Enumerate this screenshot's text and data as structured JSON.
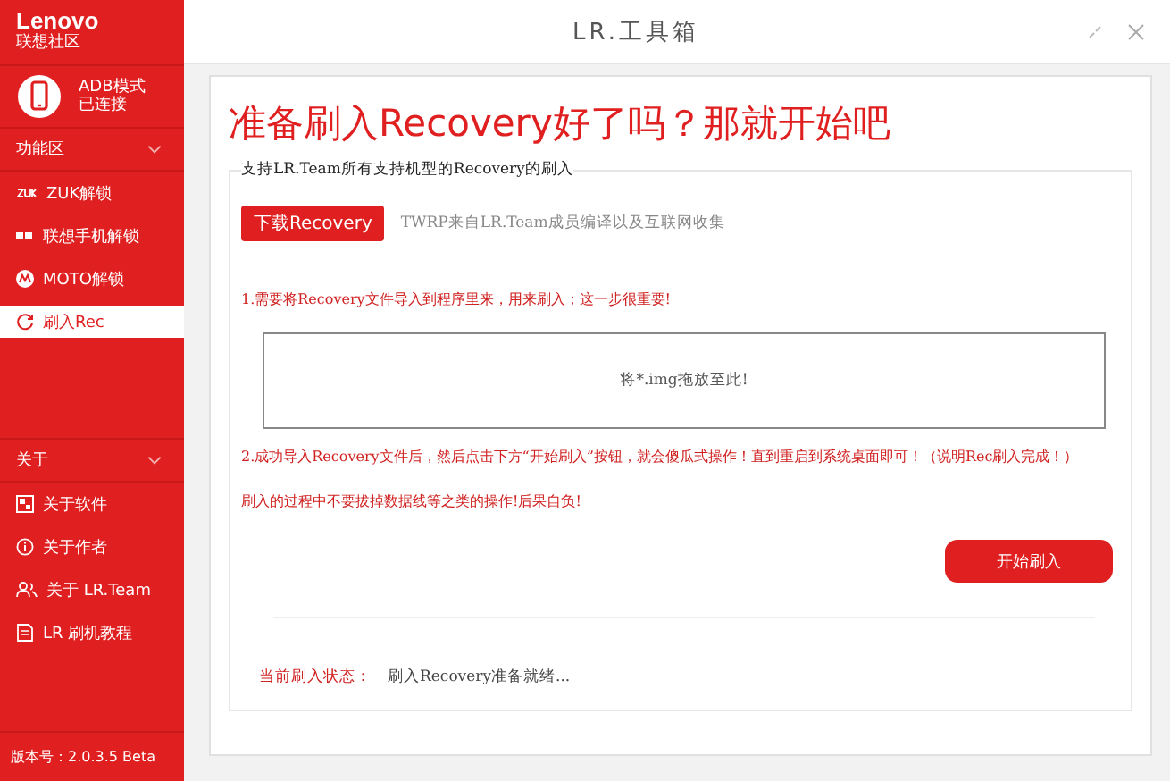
{
  "brand": {
    "name": "Lenovo",
    "subtitle": "联想社区"
  },
  "device": {
    "status_line1": "ADB模式",
    "status_line2": "已连接"
  },
  "sections": [
    {
      "title": "功能区",
      "expanded": true,
      "items": [
        {
          "label": "ZUK解锁",
          "kind": "zuk",
          "selected": false
        },
        {
          "label": "联想手机解锁",
          "kind": "grid",
          "selected": false
        },
        {
          "label": "MOTO解锁",
          "kind": "moto",
          "selected": false
        },
        {
          "label": "刷入Rec",
          "kind": "refresh",
          "selected": true
        }
      ]
    },
    {
      "title": "关于",
      "expanded": true,
      "items": [
        {
          "label": "关于软件",
          "kind": "app",
          "selected": false
        },
        {
          "label": "关于作者",
          "kind": "info",
          "selected": false
        },
        {
          "label": "关于 LR.Team",
          "kind": "people",
          "selected": false
        },
        {
          "label": "LR 刷机教程",
          "kind": "doc",
          "selected": false
        }
      ]
    }
  ],
  "version": "版本号：2.0.3.5 Beta",
  "window": {
    "title": "LR.工具箱"
  },
  "headline": "准备刷入Recovery好了吗？那就开始吧",
  "group_title": "支持LR.Team所有支持机型的Recovery的刷入",
  "download_button": "下载Recovery",
  "download_note": "TWRP来自LR.Team成员编译以及互联网收集",
  "step1": "1.需要将Recovery文件导入到程序里来，用来刷入；这一步很重要!",
  "drop_hint": "将*.img拖放至此!",
  "step2": "2.成功导入Recovery文件后，然后点击下方“开始刷入”按钮，就会傻瓜式操作！直到重启到系统桌面即可！（说明Rec刷入完成！）",
  "warning": "刷入的过程中不要拔掉数据线等之类的操作!后果自负!",
  "start_button": "开始刷入",
  "status": {
    "label": "当前刷入状态：",
    "value": "刷入Recovery准备就绪..."
  }
}
